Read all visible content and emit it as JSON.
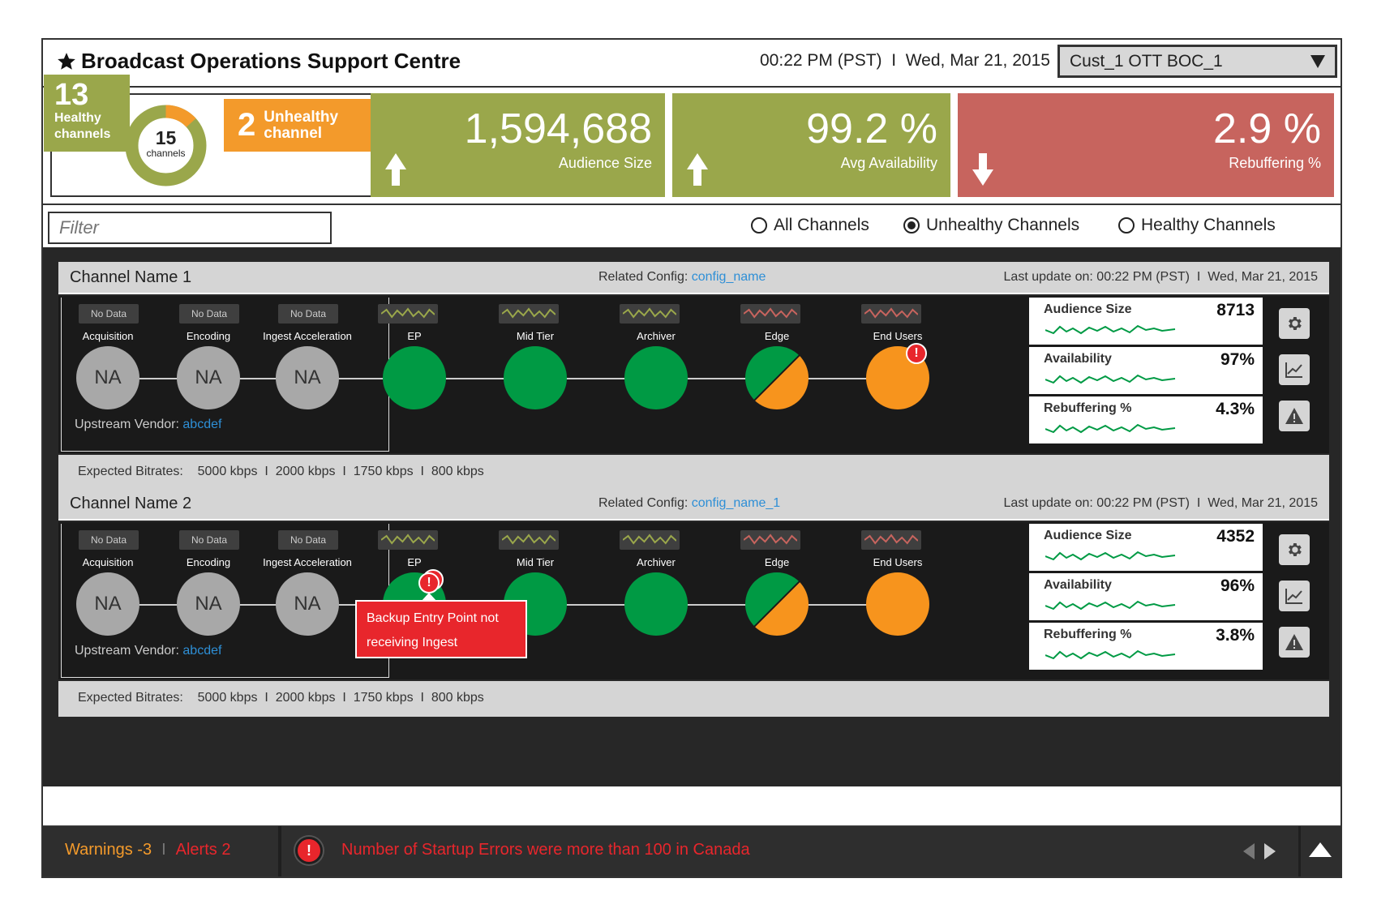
{
  "header": {
    "title": "Broadcast Operations Support Centre",
    "timestamp": "00:22 PM (PST)  I  Wed, Mar 21, 2015",
    "customer_select": "Cust_1 OTT BOC_1"
  },
  "summary": {
    "healthy_count": "13",
    "healthy_label_1": "Healthy",
    "healthy_label_2": "channels",
    "total_count": "15",
    "total_label": "channels",
    "unhealthy_count": "2",
    "unhealthy_label_1": "Unhealthy",
    "unhealthy_label_2": "channel",
    "unhealthy_fraction": 0.133
  },
  "kpis": [
    {
      "value": "1,594,688",
      "label": "Audience Size",
      "trend": "up",
      "color": "#9aa74b"
    },
    {
      "value": "99.2 %",
      "label": "Avg Availability",
      "trend": "up",
      "color": "#9aa74b"
    },
    {
      "value": "2.9 %",
      "label": "Rebuffering %",
      "trend": "down",
      "color": "#c7645e"
    }
  ],
  "filter": {
    "placeholder": "Filter",
    "options": [
      "All Channels",
      "Unhealthy Channels",
      "Healthy Channels"
    ],
    "selected": "Unhealthy Channels"
  },
  "colors": {
    "green": "#009a44",
    "orange": "#f7941d",
    "gray_node": "#a8a8a8",
    "alert_red": "#e8262c",
    "link_blue": "#2e8fd6"
  },
  "channels": [
    {
      "name": "Channel Name 1",
      "config_label": "Related Config:",
      "config_value": "config_name",
      "last_update": "Last update on: 00:22 PM (PST)  I  Wed, Mar 21, 2015",
      "upstream_label": "Upstream Vendor:",
      "upstream_value": "abcdef",
      "bitrates_label": "Expected Bitrates:",
      "bitrates": "5000 kbps  I  2000 kbps  I  1750 kbps  I  800 kbps",
      "upstream_nodes": [
        {
          "tag": "No Data",
          "label": "Acquisition",
          "value": "NA"
        },
        {
          "tag": "No Data",
          "label": "Encoding",
          "value": "NA"
        },
        {
          "tag": "No Data",
          "label": "Ingest Acceleration",
          "value": "NA"
        }
      ],
      "nodes": [
        {
          "label": "EP",
          "status": "green",
          "spark": "green",
          "error": false
        },
        {
          "label": "Mid Tier",
          "status": "green",
          "spark": "green",
          "error": false
        },
        {
          "label": "Archiver",
          "status": "green",
          "spark": "green",
          "error": false
        },
        {
          "label": "Edge",
          "status": "split",
          "spark": "red",
          "error": false
        },
        {
          "label": "End Users",
          "status": "orange",
          "spark": "red",
          "error": true
        }
      ],
      "metrics": [
        {
          "name": "Audience Size",
          "value": "8713"
        },
        {
          "name": "Availability",
          "value": "97%"
        },
        {
          "name": "Rebuffering %",
          "value": "4.3%"
        }
      ]
    },
    {
      "name": "Channel Name 2",
      "config_label": "Related Config:",
      "config_value": "config_name_1",
      "last_update": "Last update on: 00:22 PM (PST)  I  Wed, Mar 21, 2015",
      "upstream_label": "Upstream Vendor:",
      "upstream_value": "abcdef",
      "bitrates_label": "Expected Bitrates:",
      "bitrates": "5000 kbps  I  2000 kbps  I  1750 kbps  I  800 kbps",
      "upstream_nodes": [
        {
          "tag": "No Data",
          "label": "Acquisition",
          "value": "NA"
        },
        {
          "tag": "No Data",
          "label": "Encoding",
          "value": "NA"
        },
        {
          "tag": "No Data",
          "label": "Ingest Acceleration",
          "value": "NA"
        }
      ],
      "nodes": [
        {
          "label": "EP",
          "status": "green",
          "spark": "green",
          "error": true
        },
        {
          "label": "Mid Tier",
          "status": "green",
          "spark": "green",
          "error": false
        },
        {
          "label": "Archiver",
          "status": "green",
          "spark": "green",
          "error": false
        },
        {
          "label": "Edge",
          "status": "split",
          "spark": "red",
          "error": false
        },
        {
          "label": "End Users",
          "status": "orange",
          "spark": "red",
          "error": false
        }
      ],
      "metrics": [
        {
          "name": "Audience Size",
          "value": "4352"
        },
        {
          "name": "Availability",
          "value": "96%"
        },
        {
          "name": "Rebuffering %",
          "value": "3.8%"
        }
      ],
      "tooltip": "Backup Entry Point not receiving Ingest"
    }
  ],
  "statusbar": {
    "warnings": "Warnings -3",
    "separator": "I",
    "alerts": "Alerts 2",
    "message": "Number of Startup Errors were more than 100 in Canada"
  },
  "icons": [
    "star-icon",
    "dropdown-arrow-icon",
    "arrow-up-icon",
    "arrow-down-icon",
    "gear-icon",
    "line-chart-icon",
    "warning-icon",
    "error-icon",
    "chevron-left-icon",
    "chevron-right-icon",
    "collapse-up-icon"
  ]
}
